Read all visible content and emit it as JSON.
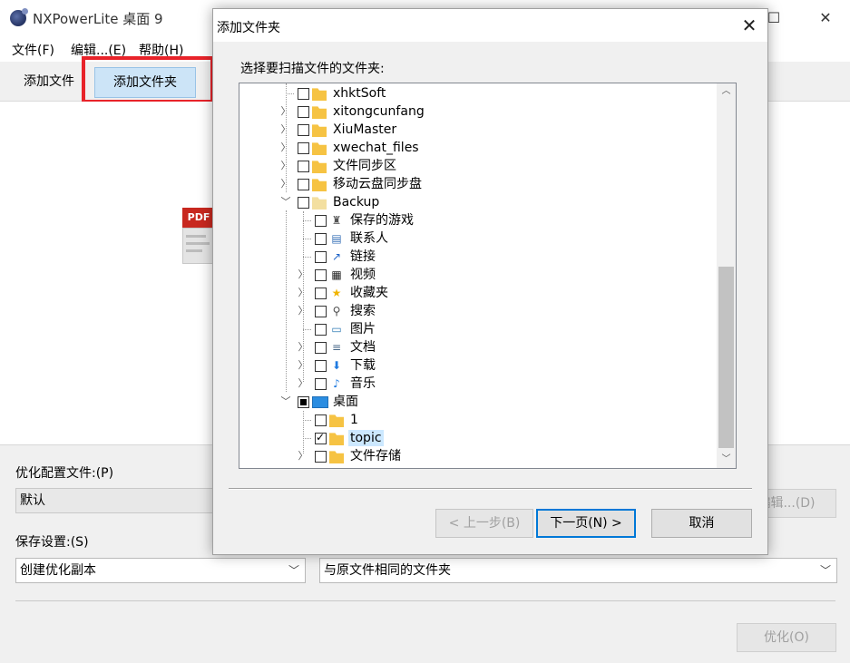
{
  "window": {
    "title": "NXPowerLite 桌面 9",
    "maximize_glyph": "☐",
    "close_glyph": "✕"
  },
  "menu": [
    "文件(F)",
    "编辑...(E)",
    "帮助(H)"
  ],
  "tabs": {
    "add_file": "添加文件",
    "add_folder": "添加文件夹"
  },
  "content": {
    "file_icon_label": "PDF"
  },
  "bottom": {
    "profile_label": "优化配置文件:(P)",
    "profile_value": "默认",
    "edit_button": "编辑...(D)",
    "save_label": "保存设置:(S)",
    "save_mode": "创建优化副本",
    "save_location": "与原文件相同的文件夹",
    "optimize_button": "优化(O)"
  },
  "dialog": {
    "title": "添加文件夹",
    "close_glyph": "✕",
    "instruction": "选择要扫描文件的文件夹:",
    "buttons": {
      "back": "< 上一步(B)",
      "next": "下一页(N) >",
      "cancel": "取消"
    },
    "tree": [
      {
        "label": "xhktSoft",
        "level": 0,
        "expander": "none",
        "state": "unchecked",
        "icon": "folder-icon"
      },
      {
        "label": "xitongcunfang",
        "level": 0,
        "expander": "collapsed",
        "state": "unchecked",
        "icon": "folder-icon"
      },
      {
        "label": "XiuMaster",
        "level": 0,
        "expander": "collapsed",
        "state": "unchecked",
        "icon": "folder-icon"
      },
      {
        "label": "xwechat_files",
        "level": 0,
        "expander": "collapsed",
        "state": "unchecked",
        "icon": "folder-icon"
      },
      {
        "label": "文件同步区",
        "level": 0,
        "expander": "collapsed",
        "state": "unchecked",
        "icon": "folder-icon"
      },
      {
        "label": "移动云盘同步盘",
        "level": 0,
        "expander": "collapsed",
        "state": "unchecked",
        "icon": "folder-icon"
      },
      {
        "label": "Backup",
        "level": 0,
        "expander": "expanded",
        "state": "unchecked",
        "icon": "folder-light-icon"
      },
      {
        "label": "保存的游戏",
        "level": 1,
        "expander": "none",
        "state": "unchecked",
        "icon": "saved-games-icon"
      },
      {
        "label": "联系人",
        "level": 1,
        "expander": "none",
        "state": "unchecked",
        "icon": "contacts-icon"
      },
      {
        "label": "链接",
        "level": 1,
        "expander": "none",
        "state": "unchecked",
        "icon": "links-icon"
      },
      {
        "label": "视频",
        "level": 1,
        "expander": "collapsed",
        "state": "unchecked",
        "icon": "videos-icon"
      },
      {
        "label": "收藏夹",
        "level": 1,
        "expander": "collapsed",
        "state": "unchecked",
        "icon": "favorites-icon"
      },
      {
        "label": "搜索",
        "level": 1,
        "expander": "collapsed",
        "state": "unchecked",
        "icon": "search-icon"
      },
      {
        "label": "图片",
        "level": 1,
        "expander": "none",
        "state": "unchecked",
        "icon": "pictures-icon"
      },
      {
        "label": "文档",
        "level": 1,
        "expander": "collapsed",
        "state": "unchecked",
        "icon": "documents-icon"
      },
      {
        "label": "下载",
        "level": 1,
        "expander": "collapsed",
        "state": "unchecked",
        "icon": "downloads-icon"
      },
      {
        "label": "音乐",
        "level": 1,
        "expander": "collapsed",
        "state": "unchecked",
        "icon": "music-icon"
      },
      {
        "label": "桌面",
        "level": 0,
        "expander": "expanded",
        "state": "partial",
        "icon": "desktop-icon"
      },
      {
        "label": "1",
        "level": 1,
        "expander": "none",
        "state": "unchecked",
        "icon": "folder-icon"
      },
      {
        "label": "topic",
        "level": 1,
        "expander": "none",
        "state": "checked",
        "icon": "folder-icon",
        "selected": true
      },
      {
        "label": "文件存储",
        "level": 1,
        "expander": "collapsed",
        "state": "unchecked",
        "icon": "folder-icon"
      }
    ]
  },
  "colors": {
    "highlight": "#e8232a",
    "selected_tab": "#cce4f7",
    "selected_row": "#cce8ff",
    "default_button_border": "#0078d7"
  }
}
